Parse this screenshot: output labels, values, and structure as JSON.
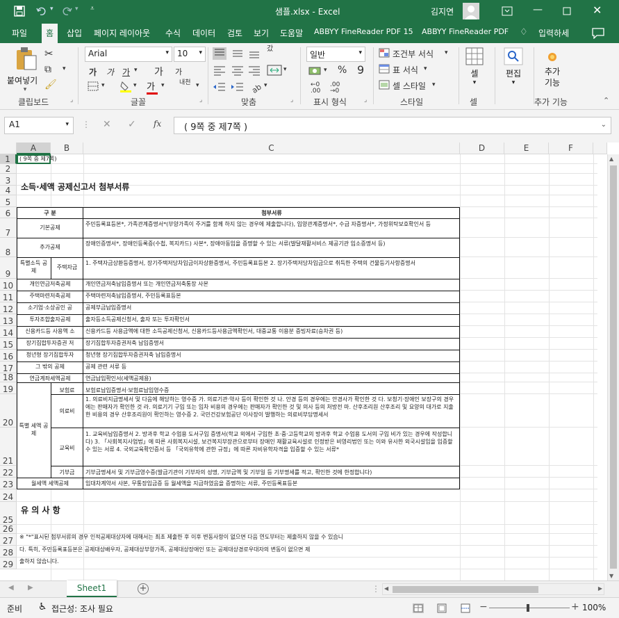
{
  "window": {
    "filename": "샘플.xlsx",
    "app": "Excel",
    "separator": "-",
    "user": "김지연",
    "icons": [
      "save-icon",
      "undo-icon",
      "redo-icon",
      "customize-icon",
      "restore-ribbon-icon",
      "minimize-icon",
      "maximize-icon",
      "close-icon"
    ]
  },
  "tabs": [
    "파일",
    "홈",
    "삽입",
    "페이지 레이아웃",
    "수식",
    "데이터",
    "검토",
    "보기",
    "도움말",
    "ABBYY FineReader PDF 15",
    "ABBYY FineReader PDF"
  ],
  "active_tab": "홈",
  "tell_me": "입력하세",
  "ribbon": {
    "clipboard": {
      "paste": "붙여넣기",
      "label": "클립보드"
    },
    "font": {
      "name": "Arial",
      "size": "10",
      "label": "글꼴",
      "bold": "가",
      "italic": "가",
      "underline": "가",
      "grow": "가",
      "shrink": "가",
      "phonetic": "내천",
      "color_a": "가"
    },
    "alignment": {
      "wrap": "갔",
      "label": "맞춤"
    },
    "number": {
      "format": "일반",
      "percent": "%",
      "comma": "9",
      "label": "표시 형식"
    },
    "styles": {
      "conditional": "조건부 서식",
      "table": "표 서식",
      "cell": "셀 스타일",
      "label": "스타일"
    },
    "cells": {
      "label": "셀"
    },
    "editing": {
      "label": "편집"
    },
    "addins": {
      "label1": "추가",
      "label2": "기능",
      "group": "추가 기능"
    }
  },
  "formula": {
    "namebox": "A1",
    "fx": "fx",
    "content": "( 9쪽 중 제7쪽 )"
  },
  "columns": [
    "A",
    "B",
    "C",
    "D",
    "E",
    "F"
  ],
  "rows": [
    "1",
    "2",
    "3",
    "4",
    "5",
    "6",
    "7",
    "8",
    "9",
    "10",
    "11",
    "12",
    "13",
    "14",
    "15",
    "16",
    "17",
    "18",
    "19",
    "20",
    "21",
    "22",
    "23",
    "24",
    "25",
    "26",
    "27",
    "28",
    "29"
  ],
  "sheet": {
    "page_no": "( 9쪽 중 제7쪽)",
    "title": "소득·세액 공제신고서 첨부서류",
    "header_left": "구 분",
    "header_right": "첨부서류",
    "r6a": "기본공제",
    "r6c": "주민등록표등본*, 가족관계증명서*(부양가족이 주거를 함께 하지 않는 경우에 제출합니다), 입양관계증명서*, 수급 자증명서*, 가정위탁보호확인서 등",
    "r7a": "추가공제",
    "r7c": "장애인증명서*, 장애인등록증(수첩, 복지카드) 사본*, 장애아동임을 증명할 수 있는 서류(발달재활서비스 제공기관 입소증명서 등)",
    "r8a": "특별소득 공제",
    "r8b": "주택자금",
    "r8c": "1. 주택자금상환등증명서, 장기주택저당차입금이자상환증명서, 주민등록표등본 2. 장기주택저당차입금으로 취득한 주택의 건물등기사항증명서",
    "r9a": "개인연금저축공제",
    "r9c": "개인연금저축납입증명서 또는 개인연금저축통장 사본",
    "r10a": "주택마련저축공제",
    "r10c": "주택마련저축납입증명서, 주민등록표등본",
    "r11a": "소기업·소상공인 공",
    "r11c": "공제부금납입증명서",
    "r12a": "투자조합출자공제",
    "r12c": "출자등소득공제신청서, 출자 또는 투자확인서",
    "r13a": "신용카드등 사용액 소",
    "r13c": "신용카드등 사용금액에 대한 소득공제신청서, 신용카드등사용금액확인서, 대중교통 이용분 증빙자료(승차권 등)",
    "r14a": "장기집합투자증권 저",
    "r14c": "장기집합투자증권저축 납입증명서",
    "r15a": "청년형 장기집합투자",
    "r15c": "청년형 장기집합투자증권저축 납입증명서",
    "r16a": "그 밖의 공제",
    "r16c": "공제 관련 서류 등",
    "r17a": "연금계좌세액공제",
    "r17c": "연금납입확인서(세액공제용)",
    "r18a": "특별 세액 공제",
    "r18b": "보험료",
    "r18c": "보험료납입증명서·보험료납입영수증",
    "r19b": "의료비",
    "r19c": "1. 의료비지급명세서 및 다음에 해당하는 영수증 가. 의료기관·약사 등이 확인한 것 나. 안경 등의 경우에는 안경사가 확인한 것 다. 보청기·장애인 보장구의 경우에는 판매자가 확인한 것 라. 의료기기 구입 또는 임차 비용의 경우에는 판매자가 확인한 것 및 의사 등의 처방전 마. 산후조리원 산후조리 및 요양의 대가로 지출한 비용의 경우 산후조리원이 확인하는 영수증 2. 국민건강보험공단 이사장이 발행하는 의료비부담명세서",
    "r20b": "교육비",
    "r20c": "1. 교육비납입증명서 2. 방과후 학교 수업용 도서구입 증명서(학교 외에서 구입한 초·중·고등학교의 방과후 학교 수업용 도서의 구입 비가 있는 경우에 작성합니다) 3. 「사회복지사업법」에 따른 사회복지시설, 보건복지부장관으로부터 장애인 재활교육시설로 인정받은 비영리법인 또는 이와 유사한 외국시설임을 입증할 수 있는 서류 4. 국외교육확인증서 등 「국외유학에 관한 규정」에 따른 자비유학자격을 입증할 수 있는 서류*",
    "r21b": "기부금",
    "r21c": "기부금명세서 및 기부금영수증(발급기관이 기부자의 성명, 기부금액 및 기부일 등 기부명세를 적고, 확인한 것에 한정합니다)",
    "r22a": "월세액 세액공제",
    "r22c": "임대차계약서 사본, 무통장입금증 등 월세액을 지급하였음을 증명하는 서류, 주민등록표등본",
    "notice_title": "유 의 사 항",
    "notice1": "※ \"*\"표시된 첨부서류의 경우 인적공제대상자에 대해서는 최초 제출한 후 이후 변동사항이 없으면 다음 연도부터는 제출하지 않을 수 있습니",
    "notice2": "다. 특히, 주민등록표등본은 공제대상배우자, 공제대상부양가족, 공제대상장애인 또는 공제대상경로우대자의 변동이 없으면 제",
    "notice3": "출하지 않습니다."
  },
  "sheettabs": {
    "active": "Sheet1",
    "add": "+"
  },
  "status": {
    "ready": "준비",
    "access": "접근성: 조사 필요",
    "zoom": "100%"
  }
}
